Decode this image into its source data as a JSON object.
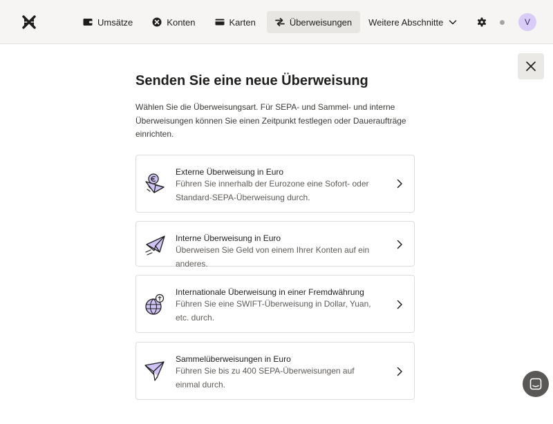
{
  "nav": {
    "items": [
      {
        "label": "Umsätze",
        "icon": "wallet-icon"
      },
      {
        "label": "Konten",
        "icon": "accounts-icon"
      },
      {
        "label": "Karten",
        "icon": "card-icon"
      },
      {
        "label": "Überweisungen",
        "icon": "transfer-icon"
      }
    ],
    "more_label": "Weitere Abschnitte",
    "active": "Überweisungen"
  },
  "user": {
    "avatar_initial": "V"
  },
  "page": {
    "title": "Senden Sie eine neue Überweisung",
    "intro": "Wählen Sie die Überweisungsart. Für SEPA- und Sammel- und interne Überweisungen können Sie einen Zeitpunkt festlegen oder Daueraufträge einrichten."
  },
  "options": [
    {
      "title": "Externe Überweisung in Euro",
      "description": "Führen Sie innerhalb der Eurozone eine Sofort- oder Standard-SEPA-Überweisung durch.",
      "icon": "euro-plane-icon"
    },
    {
      "title": "Interne Überweisung in Euro",
      "description": "Überweisen Sie Geld von einem Ihrer Konten auf ein anderes.",
      "icon": "paper-plane-icon"
    },
    {
      "title": "Internationale Überweisung in einer Fremdwährung",
      "description": "Führen Sie eine SWIFT-Überweisung in Dollar, Yuan, etc. durch.",
      "icon": "globe-plane-icon"
    },
    {
      "title": "Sammelüberweisungen in Euro",
      "description": "Führen Sie bis zu 400 SEPA-Überweisungen auf einmal durch.",
      "icon": "multi-plane-icon"
    }
  ],
  "colors": {
    "topbar_bg": "#f6f5f3",
    "nav_active_bg": "#e8e6e2",
    "avatar_bg": "#d9ccf7",
    "illustration_purple": "#cfc2f5",
    "text_primary": "#1f1e1d",
    "text_secondary": "#5e5b57"
  }
}
